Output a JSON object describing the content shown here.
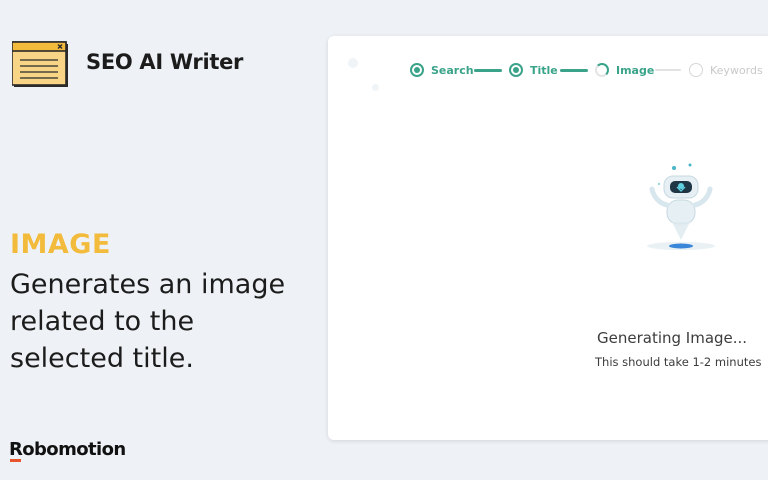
{
  "app": {
    "title": "SEO AI Writer",
    "logo_icon": "browser-window-icon"
  },
  "feature": {
    "heading": "IMAGE",
    "description": "Generates an image related to the selected title.",
    "heading_color": "#f3bb3c"
  },
  "brand": {
    "name": "Robomotion",
    "accent_color": "#e8542b"
  },
  "stepper": {
    "accent_color": "#3aa38a",
    "steps": [
      {
        "label": "Search",
        "state": "done"
      },
      {
        "label": "Title",
        "state": "done"
      },
      {
        "label": "Image",
        "state": "active"
      },
      {
        "label": "Keywords",
        "state": "pending"
      }
    ]
  },
  "status": {
    "title": "Generating Image...",
    "subtitle": "This should take 1-2 minutes",
    "illustration_icon": "robot-icon"
  }
}
